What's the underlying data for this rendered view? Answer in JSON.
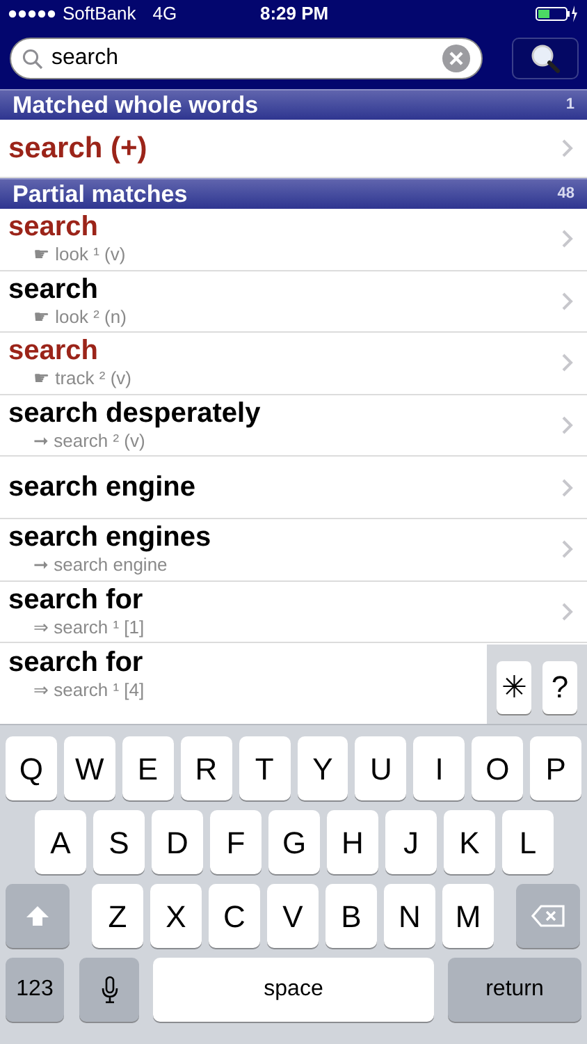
{
  "status_bar": {
    "carrier": "SoftBank",
    "network": "4G",
    "time": "8:29 PM"
  },
  "search": {
    "value": "search"
  },
  "sections": [
    {
      "title": "Matched whole words",
      "count": "1",
      "rows": [
        {
          "title": "search (+)",
          "highlighted": true
        }
      ]
    },
    {
      "title": "Partial matches",
      "count": "48",
      "rows": [
        {
          "title": "search",
          "highlighted": true,
          "subtitle": "☛ look ¹ (v)"
        },
        {
          "title": "search",
          "highlighted": false,
          "subtitle": "☛ look ² (n)"
        },
        {
          "title": "search",
          "highlighted": true,
          "subtitle": "☛ track ² (v)"
        },
        {
          "title": "search desperately",
          "highlighted": false,
          "subtitle": "➞ search ² (v)"
        },
        {
          "title": "search engine",
          "highlighted": false
        },
        {
          "title": "search engines",
          "highlighted": false,
          "subtitle": "➞ search engine"
        },
        {
          "title": "search for",
          "highlighted": false,
          "subtitle": "⇒ search ¹ [1]"
        },
        {
          "title": "search for",
          "highlighted": false,
          "subtitle": "⇒ search ¹ [4]"
        }
      ]
    }
  ],
  "wildcard_keys": [
    "✳",
    "?"
  ],
  "keyboard": [
    [
      {
        "kind": "letter",
        "label": "Q"
      },
      {
        "kind": "letter",
        "label": "W"
      },
      {
        "kind": "letter",
        "label": "E"
      },
      {
        "kind": "letter",
        "label": "R"
      },
      {
        "kind": "letter",
        "label": "T"
      },
      {
        "kind": "letter",
        "label": "Y"
      },
      {
        "kind": "letter",
        "label": "U"
      },
      {
        "kind": "letter",
        "label": "I"
      },
      {
        "kind": "letter",
        "label": "O"
      },
      {
        "kind": "letter",
        "label": "P"
      }
    ],
    [
      {
        "kind": "letter",
        "label": "A"
      },
      {
        "kind": "letter",
        "label": "S"
      },
      {
        "kind": "letter",
        "label": "D"
      },
      {
        "kind": "letter",
        "label": "F"
      },
      {
        "kind": "letter",
        "label": "G"
      },
      {
        "kind": "letter",
        "label": "H"
      },
      {
        "kind": "letter",
        "label": "J"
      },
      {
        "kind": "letter",
        "label": "K"
      },
      {
        "kind": "letter",
        "label": "L"
      }
    ],
    [
      {
        "kind": "shift"
      },
      {
        "kind": "letter",
        "label": "Z"
      },
      {
        "kind": "letter",
        "label": "X"
      },
      {
        "kind": "letter",
        "label": "C"
      },
      {
        "kind": "letter",
        "label": "V"
      },
      {
        "kind": "letter",
        "label": "B"
      },
      {
        "kind": "letter",
        "label": "N"
      },
      {
        "kind": "letter",
        "label": "M"
      },
      {
        "kind": "delete"
      }
    ],
    [
      {
        "kind": "numbers",
        "label": "123"
      },
      {
        "kind": "mic"
      },
      {
        "kind": "space",
        "label": "space"
      },
      {
        "kind": "return",
        "label": "return"
      }
    ]
  ]
}
